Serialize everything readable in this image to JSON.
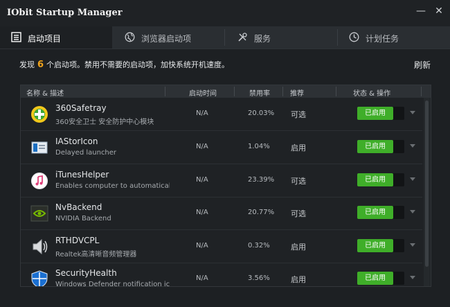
{
  "window": {
    "title": "IObit Startup Manager",
    "minimize_glyph": "—",
    "close_glyph": "✕"
  },
  "tabs": [
    {
      "label": "启动项目",
      "icon": "list-icon",
      "active": true
    },
    {
      "label": "浏览器启动项",
      "icon": "globe-icon",
      "active": false
    },
    {
      "label": "服务",
      "icon": "tools-icon",
      "active": false
    },
    {
      "label": "计划任务",
      "icon": "clock-icon",
      "active": false
    }
  ],
  "summary": {
    "prefix": "发现",
    "count": "6",
    "suffix": "个启动项。禁用不需要的启动项，加快系统开机速度。"
  },
  "refresh_label": "刷新",
  "columns": {
    "name": "名称 & 描述",
    "time": "启动时间",
    "rate": "禁用率",
    "rec": "推荐",
    "status": "状态 & 操作"
  },
  "rows": [
    {
      "name": "360Safetray",
      "desc": "360安全卫士 安全防护中心模块",
      "time": "N/A",
      "rate": "20.03%",
      "rec": "可选",
      "status": "已启用",
      "icon": "360-safe-icon"
    },
    {
      "name": "IAStorIcon",
      "desc": "Delayed launcher",
      "time": "N/A",
      "rate": "1.04%",
      "rec": "启用",
      "status": "已启用",
      "icon": "intel-storage-icon"
    },
    {
      "name": "iTunesHelper",
      "desc": "Enables computer to automatically r...",
      "time": "N/A",
      "rate": "23.39%",
      "rec": "可选",
      "status": "已启用",
      "icon": "itunes-icon"
    },
    {
      "name": "NvBackend",
      "desc": "NVIDIA Backend",
      "time": "N/A",
      "rate": "20.77%",
      "rec": "可选",
      "status": "已启用",
      "icon": "nvidia-icon"
    },
    {
      "name": "RTHDVCPL",
      "desc": "Realtek高清晰音频管理器",
      "time": "N/A",
      "rate": "0.32%",
      "rec": "启用",
      "status": "已启用",
      "icon": "speaker-icon"
    },
    {
      "name": "SecurityHealth",
      "desc": "Windows Defender notification icon",
      "time": "N/A",
      "rate": "3.56%",
      "rec": "启用",
      "status": "已启用",
      "icon": "shield-icon"
    }
  ],
  "colors": {
    "accent_green": "#3fae29",
    "count_orange": "#f0a31c",
    "background": "#1d2023"
  }
}
